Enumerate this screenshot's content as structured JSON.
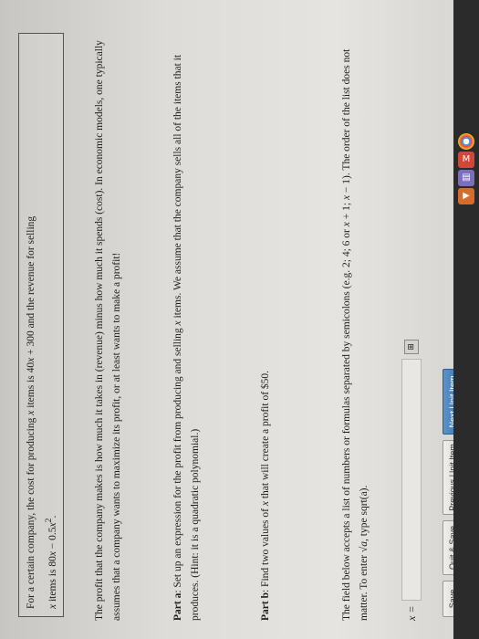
{
  "problem": {
    "text_a": "For a certain company, the cost for producing ",
    "var_x": "x",
    "text_b": " items is 40",
    "text_c": " + 300 and the revenue for selling",
    "text_d": " items is 80",
    "text_e": " − 0.5",
    "sup2": "2",
    "text_f": "."
  },
  "para1": "The profit that the company makes is how much it takes in (revenue) minus how much it spends (cost). In economic models, one typically assumes that a company wants to maximize its profit, or at least wants to make a profit!",
  "parta": {
    "label": "Part a",
    "text_a": ": Set up an expression for the profit from producing and selling ",
    "text_b": " items. We assume that the company sells all of the items that it produces. (Hint: it is a quadratic polynomial.)"
  },
  "partb": {
    "label": "Part b",
    "text_a": ": Find two values of ",
    "text_b": " that will create a profit of $50."
  },
  "field_note": {
    "text_a": "The field below accepts a list of numbers or formulas separated by semicolons (e.g. 2; 4; 6 or ",
    "text_b": " + 1; ",
    "text_c": " − 1). The order of the list does not matter. To enter √",
    "var_a": "a",
    "text_d": ", type sqrt(a)."
  },
  "answer": {
    "label": "x =",
    "value": ""
  },
  "buttons": {
    "save": "Save",
    "quit_save": "Quit & Save",
    "previous": "Previous Unit Item",
    "next": "Next Unit Item"
  }
}
